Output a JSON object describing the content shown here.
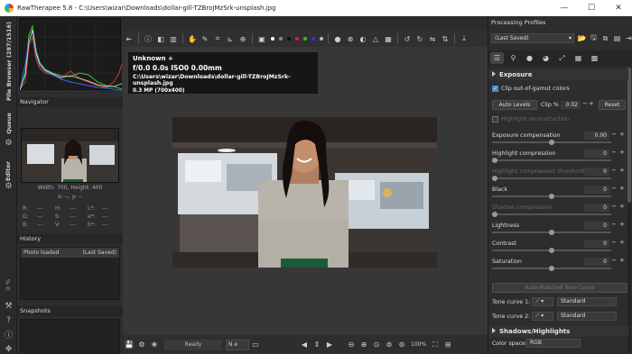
{
  "titlebar": {
    "title": "RawTherapee 5.8 - C:\\Users\\wizar\\Downloads\\dollar-gill-TZBroJMzSrk-unsplash.jpg",
    "minimize": "—",
    "maximize": "☐",
    "close": "✕"
  },
  "vertical_tabs": {
    "file_browser": "File Browser (287/1516)",
    "queue": "Queue",
    "editor": "Editor",
    "zoom_percent": "0 %"
  },
  "navigator": {
    "title": "Navigator",
    "size_text": "Width: 700, Height: 400",
    "coords": "x: --, y: --",
    "readout": [
      [
        {
          "k": "R:",
          "v": "---"
        },
        {
          "k": "H:",
          "v": "---"
        },
        {
          "k": "L*:",
          "v": "---"
        }
      ],
      [
        {
          "k": "G:",
          "v": "---"
        },
        {
          "k": "S:",
          "v": "---"
        },
        {
          "k": "a*:",
          "v": "---"
        }
      ],
      [
        {
          "k": "B:",
          "v": "---"
        },
        {
          "k": "V:",
          "v": "---"
        },
        {
          "k": "b*:",
          "v": "---"
        }
      ]
    ]
  },
  "history": {
    "title": "History",
    "col1": "Photo loaded",
    "col2": "(Last Saved)"
  },
  "snapshots": {
    "title": "Snapshots",
    "add": "+",
    "remove": "−"
  },
  "preview_info": {
    "camera": "Unknown +",
    "exposure": "f/0.0  0.0s  ISO0  0.00mm",
    "path": "C:\\Users\\wizar\\Downloads\\dollar-gill-TZBroJMzSrk-unsplash.jpg",
    "size": "0.3 MP (700x400)"
  },
  "bottombar": {
    "status": "Ready",
    "combo": "N.e",
    "zoom": "100%"
  },
  "processing_profiles": {
    "title": "Processing Profiles",
    "selected": "(Last Saved)"
  },
  "exposure": {
    "title": "Exposure",
    "clip_out_of_gamut": "Clip out-of-gamut colors",
    "auto_levels": "Auto Levels",
    "clip_label": "Clip %",
    "clip_value": "0.02",
    "reset": "Reset",
    "highlight_reconstruction": "Highlight reconstruction",
    "sliders": [
      {
        "label": "Exposure compensation",
        "value": "0.00",
        "dim": false,
        "pos": 0.5
      },
      {
        "label": "Highlight compression",
        "value": "0",
        "dim": false,
        "pos": 0.0
      },
      {
        "label": "Highlight compression threshold",
        "value": "0",
        "dim": true,
        "pos": 0.0
      },
      {
        "label": "Black",
        "value": "0",
        "dim": false,
        "pos": 0.5
      },
      {
        "label": "Shadow compression",
        "value": "0",
        "dim": true,
        "pos": 0.0
      },
      {
        "label": "Lightness",
        "value": "0",
        "dim": false,
        "pos": 0.5
      },
      {
        "label": "Contrast",
        "value": "0",
        "dim": false,
        "pos": 0.5
      },
      {
        "label": "Saturation",
        "value": "0",
        "dim": false,
        "pos": 0.5
      }
    ],
    "auto_matched_tone_curve": "Auto-Matched Tone Curve",
    "tone_curve_1": "Tone curve 1:",
    "tone_curve_2": "Tone curve 2:",
    "tone_curve_mode": "Standard"
  },
  "shadows_highlights": {
    "title": "Shadows/Highlights",
    "color_space_label": "Color space:",
    "color_space": "RGB"
  }
}
